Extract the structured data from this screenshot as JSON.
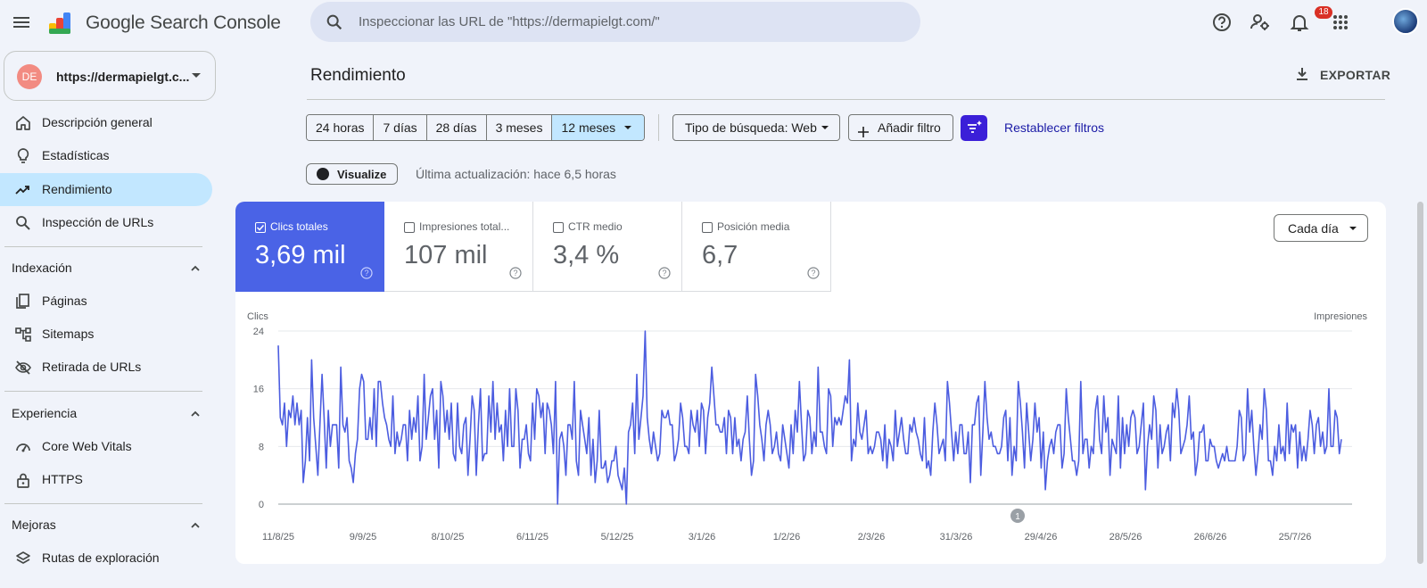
{
  "app": {
    "brand": "Google Search Console",
    "search_placeholder": "Inspeccionar las URL de \"https://dermapielgt.com/\"",
    "notification_count": "18",
    "icons": [
      "menu-icon",
      "help-icon",
      "manage-users-icon",
      "bell-icon",
      "apps-icon",
      "account-avatar"
    ]
  },
  "property": {
    "avatar_initials": "DE",
    "name": "https://dermapielgt.c..."
  },
  "sidebar": {
    "top_items": [
      {
        "label": "Descripción general",
        "icon": "home-icon"
      },
      {
        "label": "Estadísticas",
        "icon": "lightbulb-icon"
      },
      {
        "label": "Rendimiento",
        "icon": "trending-up-icon",
        "active": true
      },
      {
        "label": "Inspección de URLs",
        "icon": "search-icon"
      }
    ],
    "sections": [
      {
        "title": "Indexación",
        "items": [
          {
            "label": "Páginas",
            "icon": "pages-icon"
          },
          {
            "label": "Sitemaps",
            "icon": "sitemap-icon"
          },
          {
            "label": "Retirada de URLs",
            "icon": "eye-off-icon"
          }
        ]
      },
      {
        "title": "Experiencia",
        "items": [
          {
            "label": "Core Web Vitals",
            "icon": "speedometer-icon"
          },
          {
            "label": "HTTPS",
            "icon": "lock-icon"
          }
        ]
      },
      {
        "title": "Mejoras",
        "items": [
          {
            "label": "Rutas de exploración",
            "icon": "layers-icon"
          }
        ]
      }
    ]
  },
  "header": {
    "title": "Rendimiento",
    "export_label": "EXPORTAR"
  },
  "filters": {
    "ranges": [
      "24 horas",
      "7 días",
      "28 días",
      "3 meses",
      "12 meses"
    ],
    "selected_range": "12 meses",
    "search_type": "Tipo de búsqueda: Web",
    "add_filter": "Añadir filtro",
    "reset": "Restablecer filtros"
  },
  "visualize": {
    "label": "Visualize",
    "last_update": "Última actualización: hace 6,5 horas"
  },
  "metrics": [
    {
      "label": "Clics totales",
      "value": "3,69 mil",
      "checked": true
    },
    {
      "label": "Impresiones total...",
      "value": "107 mil",
      "checked": false
    },
    {
      "label": "CTR medio",
      "value": "3,4 %",
      "checked": false
    },
    {
      "label": "Posición media",
      "value": "6,7",
      "checked": false
    }
  ],
  "granularity": "Cada día",
  "colors": {
    "accent": "#4a63e6",
    "selected_bg": "#c2e7ff",
    "ai_button": "#3b1fd8",
    "link": "#1a1aa6",
    "line": "#4c5de0"
  },
  "chart_data": {
    "type": "line",
    "ylabel_left": "Clics",
    "ylabel_right": "Impresiones",
    "yticks": [
      0,
      8,
      16,
      24
    ],
    "ylim": [
      0,
      24
    ],
    "grid": true,
    "x_tick_labels": [
      "11/8/25",
      "9/9/25",
      "8/10/25",
      "6/11/25",
      "5/12/25",
      "3/1/26",
      "1/2/26",
      "2/3/26",
      "31/3/26",
      "29/4/26",
      "28/5/26",
      "26/6/26",
      "25/7/26"
    ],
    "annotation": "1",
    "series": [
      {
        "name": "Clics totales",
        "values": [
          22,
          12,
          11,
          14,
          8,
          13,
          12,
          15,
          11,
          14,
          11,
          13,
          3,
          6,
          12,
          6,
          20,
          12,
          8,
          4,
          11,
          18,
          12,
          5,
          13,
          8,
          11,
          11,
          11,
          5,
          19,
          11,
          10,
          12,
          6,
          5,
          3,
          7,
          9,
          16,
          18,
          17,
          9,
          9,
          12,
          9,
          16,
          8,
          17,
          17,
          14,
          12,
          11,
          9,
          8,
          15,
          7,
          10,
          8,
          9,
          11,
          11,
          6,
          13,
          9,
          12,
          10,
          15,
          6,
          8,
          18,
          9,
          12,
          15,
          16,
          9,
          13,
          5,
          17,
          15,
          10,
          13,
          9,
          14,
          7,
          6,
          14,
          8,
          7,
          11,
          12,
          4,
          9,
          15,
          13,
          4,
          11,
          16,
          6,
          7,
          7,
          15,
          10,
          17,
          9,
          14,
          10,
          11,
          6,
          13,
          8,
          16,
          8,
          8,
          16,
          13,
          5,
          9,
          9,
          11,
          7,
          6,
          14,
          9,
          16,
          15,
          12,
          14,
          7,
          14,
          13,
          11,
          7,
          17,
          0,
          9,
          10,
          8,
          4,
          11,
          11,
          9,
          17,
          6,
          4,
          13,
          11,
          9,
          7,
          12,
          4,
          9,
          3,
          6,
          13,
          5,
          5,
          6,
          3,
          4,
          6,
          6,
          8,
          4,
          3,
          2,
          5,
          0,
          10,
          11,
          14,
          7,
          18,
          9,
          12,
          15,
          24,
          12,
          9,
          7,
          10,
          8,
          6,
          7,
          13,
          12,
          12,
          13,
          11,
          11,
          6,
          7,
          9,
          14,
          12,
          8,
          8,
          7,
          13,
          11,
          10,
          13,
          8,
          14,
          13,
          7,
          12,
          14,
          19,
          15,
          11,
          11,
          10,
          10,
          12,
          7,
          13,
          12,
          7,
          12,
          8,
          9,
          6,
          9,
          10,
          15,
          9,
          4,
          6,
          18,
          15,
          11,
          9,
          6,
          11,
          13,
          11,
          7,
          8,
          10,
          7,
          6,
          11,
          9,
          7,
          5,
          11,
          7,
          13,
          10,
          17,
          11,
          6,
          7,
          13,
          12,
          7,
          10,
          8,
          19,
          10,
          10,
          8,
          7,
          16,
          15,
          8,
          12,
          11,
          12,
          11,
          13,
          15,
          14,
          20,
          6,
          9,
          8,
          14,
          10,
          9,
          11,
          13,
          7,
          8,
          7,
          8,
          10,
          10,
          9,
          6,
          11,
          5,
          9,
          8,
          6,
          13,
          8,
          10,
          12,
          9,
          7,
          7,
          11,
          10,
          12,
          10,
          9,
          7,
          6,
          12,
          5,
          6,
          4,
          10,
          14,
          11,
          7,
          8,
          9,
          6,
          17,
          14,
          10,
          6,
          10,
          7,
          11,
          11,
          7,
          7,
          10,
          3,
          11,
          11,
          14,
          15,
          4,
          10,
          17,
          12,
          9,
          10,
          8,
          8,
          7,
          7,
          8,
          12,
          13,
          6,
          12,
          4,
          8,
          6,
          17,
          14,
          10,
          5,
          14,
          10,
          6,
          9,
          14,
          10,
          12,
          5,
          10,
          2,
          6,
          8,
          9,
          7,
          10,
          11,
          11,
          5,
          7,
          16,
          12,
          9,
          6,
          6,
          4,
          6,
          17,
          7,
          9,
          9,
          5,
          8,
          7,
          13,
          15,
          9,
          7,
          15,
          10,
          12,
          4,
          9,
          8,
          7,
          15,
          5,
          12,
          7,
          11,
          8,
          12,
          13,
          12,
          7,
          8,
          11,
          14,
          2,
          8,
          11,
          9,
          15,
          13,
          5,
          11,
          7,
          8,
          10,
          11,
          6,
          14,
          12,
          16,
          13,
          7,
          8,
          9,
          11,
          15,
          9,
          10,
          4,
          6,
          10,
          10,
          11,
          6,
          6,
          9,
          8,
          8,
          6,
          5,
          6,
          7,
          6,
          8,
          6,
          6,
          6,
          6,
          8,
          13,
          12,
          6,
          7,
          16,
          10,
          13,
          8,
          4,
          7,
          11,
          9,
          16,
          13,
          6,
          6,
          4,
          8,
          6,
          11,
          7,
          8,
          6,
          14,
          7,
          11,
          10,
          11,
          5,
          10,
          6,
          8,
          6,
          9,
          13,
          11,
          7,
          11,
          12,
          8,
          10,
          7,
          8,
          16,
          8,
          8,
          13,
          12,
          7,
          9
        ]
      }
    ]
  }
}
